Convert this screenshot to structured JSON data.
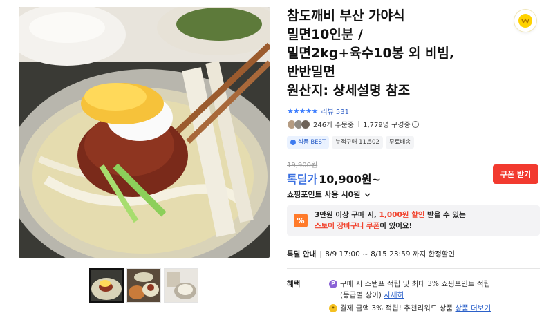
{
  "product": {
    "title_lines": [
      "참도깨비 부산 가야식",
      "밀면10인분 /",
      "밀면2kg+육수10봉 외 비빔,",
      "반반밀면",
      "원산지: 상세설명 참조"
    ],
    "rating_stars": "★★★★★",
    "review_label": "리뷰",
    "review_count": "531",
    "orders": "246개 주문중",
    "viewers": "1,779명 구경중",
    "tags": [
      "식품 BEST",
      "누적구매 11,502",
      "무료배송"
    ],
    "original_price": "19,900원",
    "deal_label": "톡딜가",
    "price": "10,900원~",
    "coupon_button": "쿠폰 받기",
    "points_text": "쇼핑포인트 사용 시0원"
  },
  "coupon_notice": {
    "part1": "3만원 이상 구매 시, ",
    "highlight1": "1,000원 할인",
    "part2": " 받을 수 있는",
    "highlight2": "스토어 장바구니 쿠폰",
    "part3": "이 있어요!"
  },
  "deal_info": {
    "label": "톡딜 안내",
    "text": "8/9 17:00 ~ 8/15 23:59 까지 한정할인"
  },
  "benefits": {
    "label": "혜택",
    "item1_text": "구매 시 스탬프 적립 및 최대 3% 쇼핑포인트 적립",
    "item1_sub": "(등급별 상이)",
    "item1_link": "자세히",
    "item2_text": "결제 금액 3% 적립! 추천리워드 상품",
    "item2_link": "상품 더보기"
  },
  "colors": {
    "accent": "#3a6fe0",
    "coupon_red": "#f23a2f",
    "star_blue": "#3a7cff"
  },
  "icons": [
    "deal-badge-icon",
    "info-icon",
    "coupon-percent-icon",
    "points-p-icon",
    "reward-coin-icon",
    "chevron-down-icon"
  ]
}
